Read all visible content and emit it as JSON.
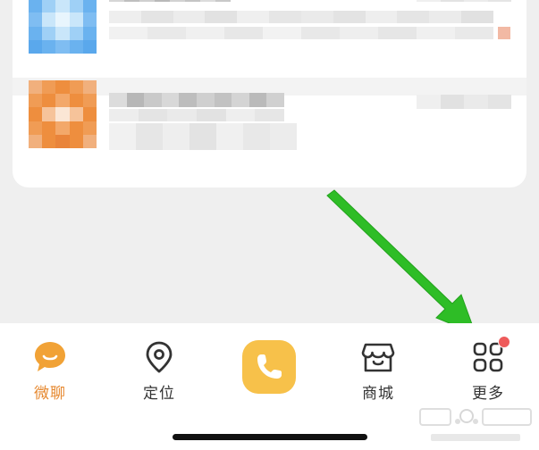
{
  "tabbar": {
    "tabs": [
      {
        "label": "微聊",
        "icon": "chat-bubble-icon",
        "active": true
      },
      {
        "label": "定位",
        "icon": "location-pin-icon",
        "active": false
      },
      {
        "label": "",
        "icon": "phone-icon",
        "active": false
      },
      {
        "label": "商城",
        "icon": "shop-icon",
        "active": false
      },
      {
        "label": "更多",
        "icon": "grid-more-icon",
        "active": false,
        "badge": true
      }
    ]
  },
  "colors": {
    "accent": "#e6872d",
    "call_button": "#f7c14a",
    "badge": "#ee5b5b",
    "arrow": "#2ebd26"
  }
}
